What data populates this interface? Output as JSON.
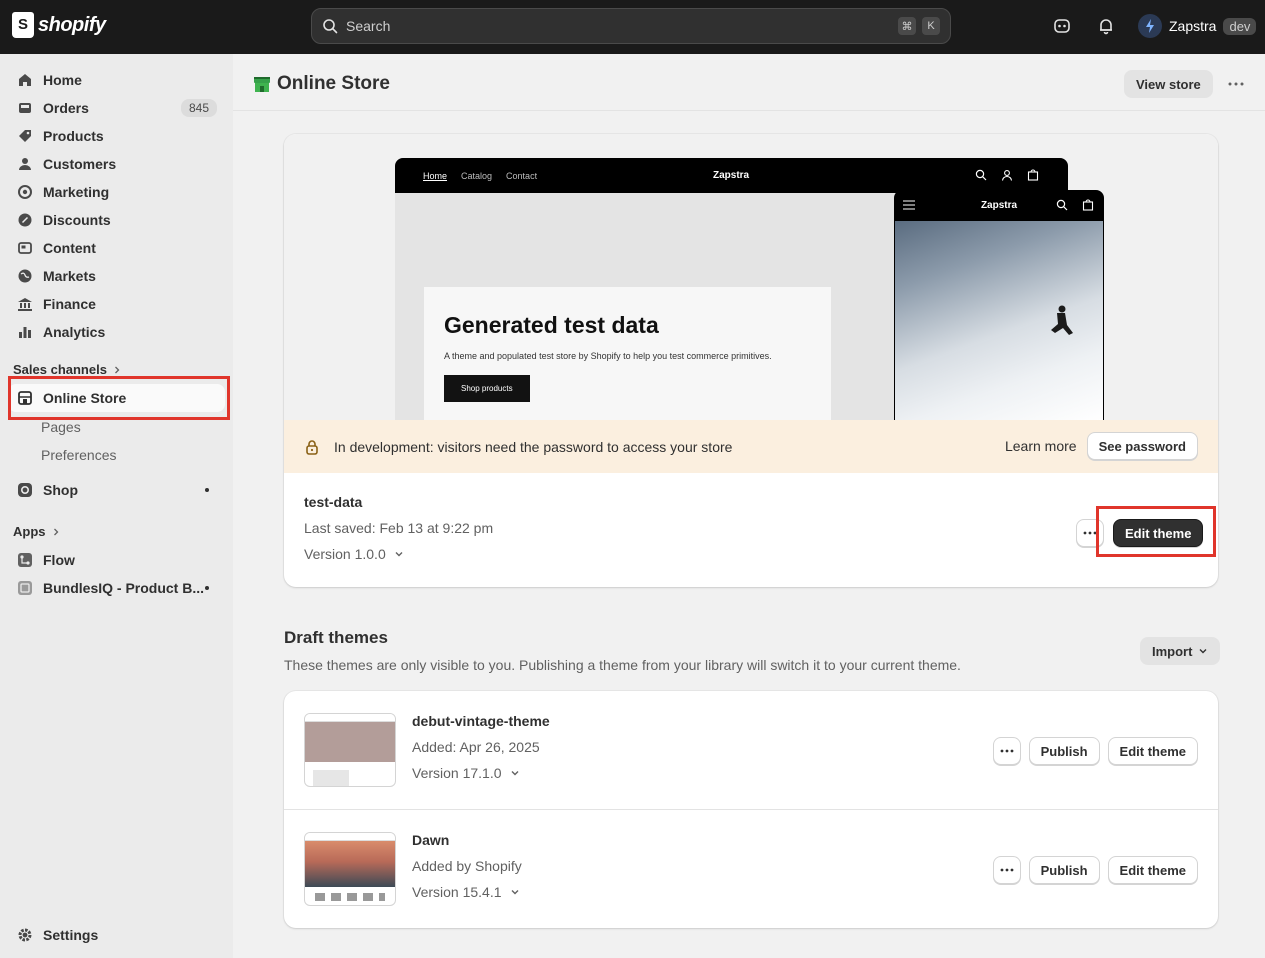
{
  "topbar": {
    "brand": "shopify",
    "search_placeholder": "Search",
    "shortcut_cmd": "⌘",
    "shortcut_key": "K",
    "user_name": "Zapstra",
    "user_badge": "dev"
  },
  "sidebar": {
    "items": [
      {
        "label": "Home",
        "icon": "home-icon"
      },
      {
        "label": "Orders",
        "icon": "orders-icon",
        "count": "845"
      },
      {
        "label": "Products",
        "icon": "tag-icon"
      },
      {
        "label": "Customers",
        "icon": "person-icon"
      },
      {
        "label": "Marketing",
        "icon": "target-icon"
      },
      {
        "label": "Discounts",
        "icon": "discount-icon"
      },
      {
        "label": "Content",
        "icon": "content-icon"
      },
      {
        "label": "Markets",
        "icon": "globe-icon"
      },
      {
        "label": "Finance",
        "icon": "bank-icon"
      },
      {
        "label": "Analytics",
        "icon": "chart-icon"
      }
    ],
    "sales_channels_label": "Sales channels",
    "online_store_label": "Online Store",
    "online_store_sub": [
      "Pages",
      "Preferences"
    ],
    "shop_label": "Shop",
    "apps_label": "Apps",
    "apps": [
      "Flow",
      "BundlesIQ - Product B..."
    ],
    "settings_label": "Settings"
  },
  "header": {
    "title": "Online Store",
    "view_store_label": "View store"
  },
  "preview": {
    "desk_nav": [
      "Home",
      "Catalog",
      "Contact"
    ],
    "desk_brand": "Zapstra",
    "mobile_brand": "Zapstra",
    "hero_title": "Generated test data",
    "hero_sub": "A theme and populated test store by Shopify to help you test commerce primitives.",
    "hero_button": "Shop products"
  },
  "banner": {
    "text": "In development: visitors need the password to access your store",
    "learn_more": "Learn more",
    "see_password": "See password"
  },
  "current_theme": {
    "name": "test-data",
    "saved": "Last saved: Feb 13 at 9:22 pm",
    "version": "Version 1.0.0",
    "edit_label": "Edit theme"
  },
  "drafts": {
    "title": "Draft themes",
    "subtitle": "These themes are only visible to you. Publishing a theme from your library will switch it to your current theme.",
    "import_label": "Import",
    "publish_label": "Publish",
    "edit_label": "Edit theme",
    "themes": [
      {
        "name": "debut-vintage-theme",
        "added": "Added: Apr 26, 2025",
        "version": "Version 17.1.0"
      },
      {
        "name": "Dawn",
        "added": "Added by Shopify",
        "version": "Version 15.4.1"
      }
    ]
  },
  "colors": {
    "topbar": "#1a1a1a",
    "highlight": "#e0352b",
    "banner": "#fbefdf"
  }
}
